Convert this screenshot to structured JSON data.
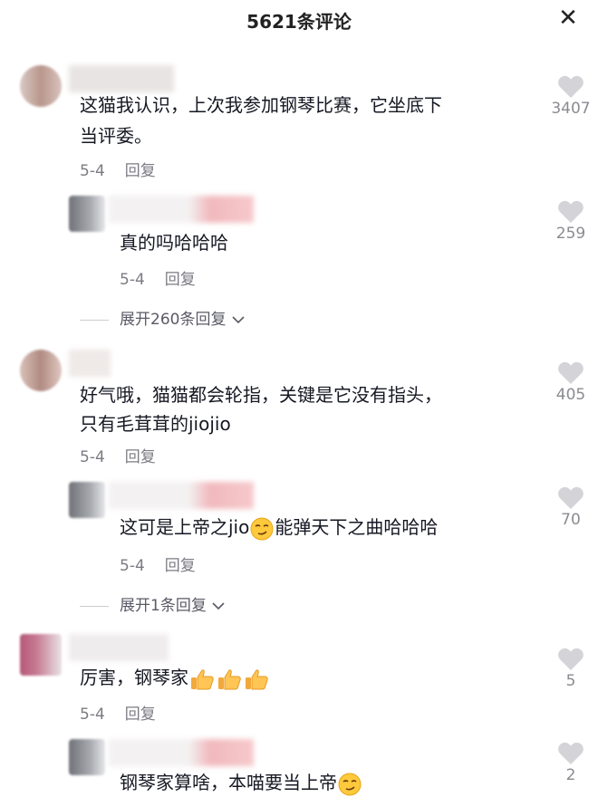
{
  "header": {
    "title": "5621条评论",
    "close_icon": "close-icon"
  },
  "comments": [
    {
      "line1": "这猫我认识，上次我参加钢琴比赛，它坐底下",
      "line2": "当评委。",
      "date": "5-4",
      "reply": "回复",
      "likes": "3407"
    },
    {
      "text": "真的吗哈哈哈",
      "date": "5-4",
      "reply": "回复",
      "likes": "259"
    },
    {
      "expand": "展开260条回复"
    },
    {
      "line1": "好气哦，猫猫都会轮指，关键是它没有指头，",
      "line2": "只有毛茸茸的jiojio",
      "date": "5-4",
      "reply": "回复",
      "likes": "405"
    },
    {
      "text_a": "这可是上帝之jio",
      "text_b": "能弹天下之曲哈哈哈",
      "date": "5-4",
      "reply": "回复",
      "likes": "70"
    },
    {
      "expand": "展开1条回复"
    },
    {
      "text": "厉害，钢琴家",
      "date": "5-4",
      "reply": "回复",
      "likes": "5"
    },
    {
      "text": "钢琴家算啥，本喵要当上帝",
      "likes": "2"
    }
  ]
}
